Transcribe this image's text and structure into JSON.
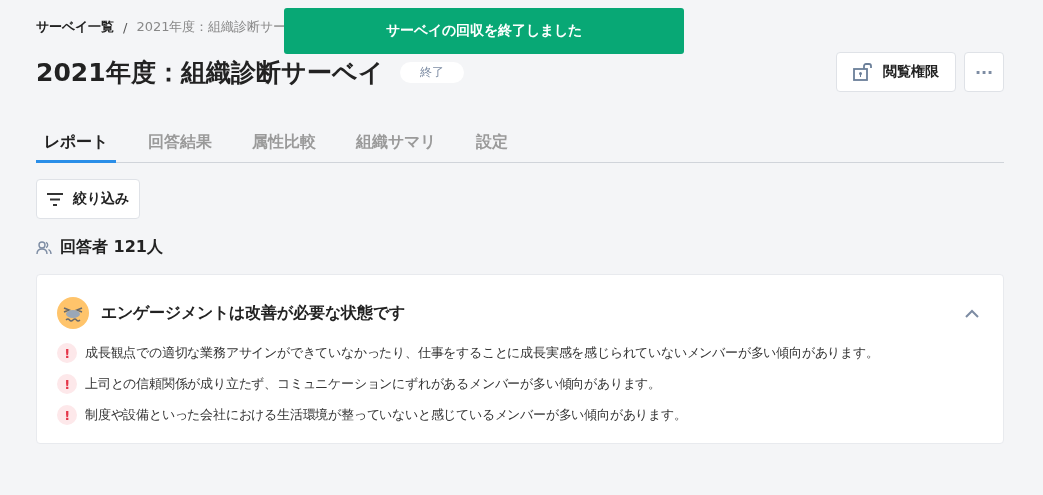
{
  "breadcrumb": [
    {
      "label": "サーベイ一覧",
      "current": false
    },
    {
      "label": "2021年度：組織診断サー",
      "current": true
    }
  ],
  "breadcrumb_separator": "/",
  "title": "2021年度：組織診断サーベイ",
  "status_badge": "終了",
  "toast": "サーベイの回収を終了しました",
  "actions": {
    "permissions_button": "閲覧権限",
    "more_button": "···"
  },
  "tabs": [
    {
      "label": "レポート",
      "selected": true
    },
    {
      "label": "回答結果",
      "selected": false
    },
    {
      "label": "属性比較",
      "selected": false
    },
    {
      "label": "組織サマリ",
      "selected": false
    },
    {
      "label": "設定",
      "selected": false
    }
  ],
  "filter_button": "絞り込み",
  "respondents": "回答者 121人",
  "card": {
    "title": "エンゲージメントは改善が必要な状態です",
    "expanded": true,
    "alert_mark": "!",
    "items": [
      "成長観点での適切な業務アサインができていなかったり、仕事をすることに成長実感を感じられていないメンバーが多い傾向があります。",
      "上司との信頼関係が成り立たず、コミュニケーションにずれがあるメンバーが多い傾向があります。",
      "制度や設備といった会社における生活環境が整っていないと感じているメンバーが多い傾向があります。"
    ]
  }
}
